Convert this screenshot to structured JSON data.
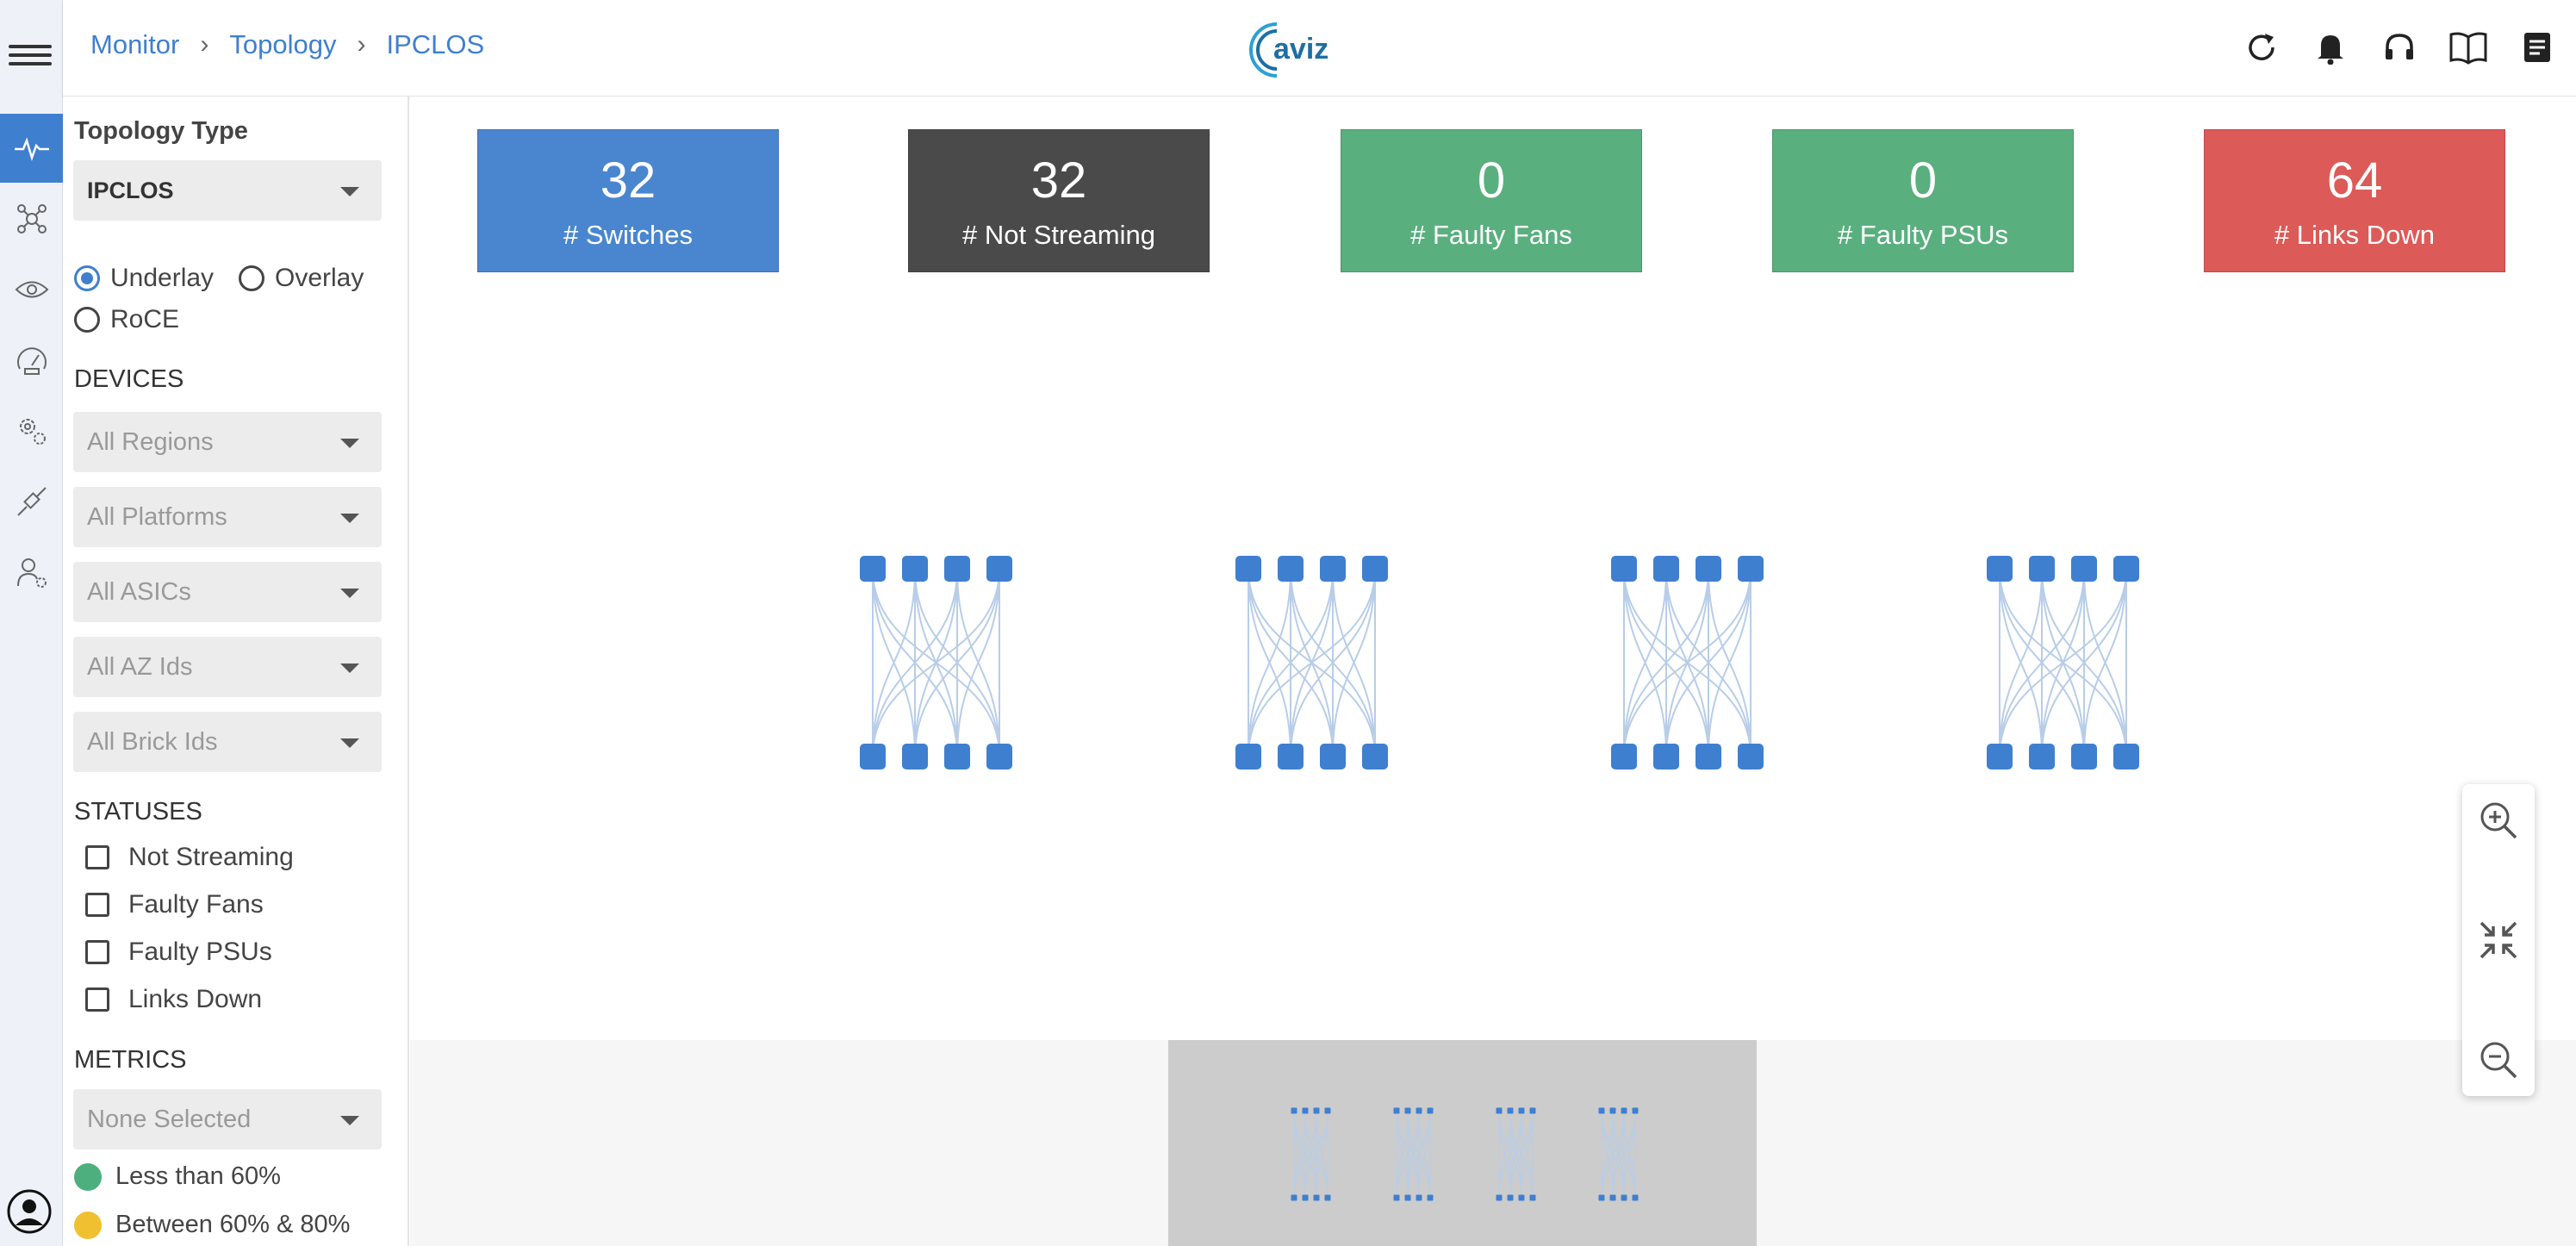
{
  "breadcrumb": [
    "Monitor",
    "Topology",
    "IPCLOS"
  ],
  "logo": {
    "text": "aviz"
  },
  "header_icons": [
    "refresh-icon",
    "bell-icon",
    "headset-icon",
    "book-icon",
    "document-icon"
  ],
  "rail_icons": [
    "pulse-icon",
    "network-icon",
    "eye-icon",
    "speedometer-icon",
    "gears-icon",
    "plug-icon",
    "user-settings-icon"
  ],
  "sidebar": {
    "topology_type_label": "Topology Type",
    "topology_type_value": "IPCLOS",
    "layer_options": [
      "Underlay",
      "Overlay",
      "RoCE"
    ],
    "layer_selected": "Underlay",
    "devices_label": "DEVICES",
    "device_filters": [
      "All Regions",
      "All Platforms",
      "All ASICs",
      "All AZ Ids",
      "All Brick Ids"
    ],
    "statuses_label": "STATUSES",
    "statuses": [
      "Not Streaming",
      "Faulty Fans",
      "Faulty PSUs",
      "Links Down"
    ],
    "metrics_label": "METRICS",
    "metrics_value": "None Selected",
    "legend": [
      {
        "label": "Less than 60%",
        "color": "#4caf7d"
      },
      {
        "label": "Between 60% & 80%",
        "color": "#f0c030"
      }
    ]
  },
  "cards": [
    {
      "value": "32",
      "label": "# Switches",
      "color": "#4a86cf"
    },
    {
      "value": "32",
      "label": "# Not Streaming",
      "color": "#4a4a4a"
    },
    {
      "value": "0",
      "label": "# Faulty Fans",
      "color": "#5aaf7f"
    },
    {
      "value": "0",
      "label": "# Faulty PSUs",
      "color": "#5aaf7f"
    },
    {
      "value": "64",
      "label": "# Links Down",
      "color": "#dc5a57"
    }
  ],
  "topology": {
    "pods": 4,
    "spines_per_pod": 4,
    "leaves_per_pod": 4,
    "node_color": "#3f7fd0",
    "link_color": "#b8cde8"
  },
  "zoom_controls": [
    "zoom-in-icon",
    "fit-icon",
    "zoom-out-icon"
  ]
}
